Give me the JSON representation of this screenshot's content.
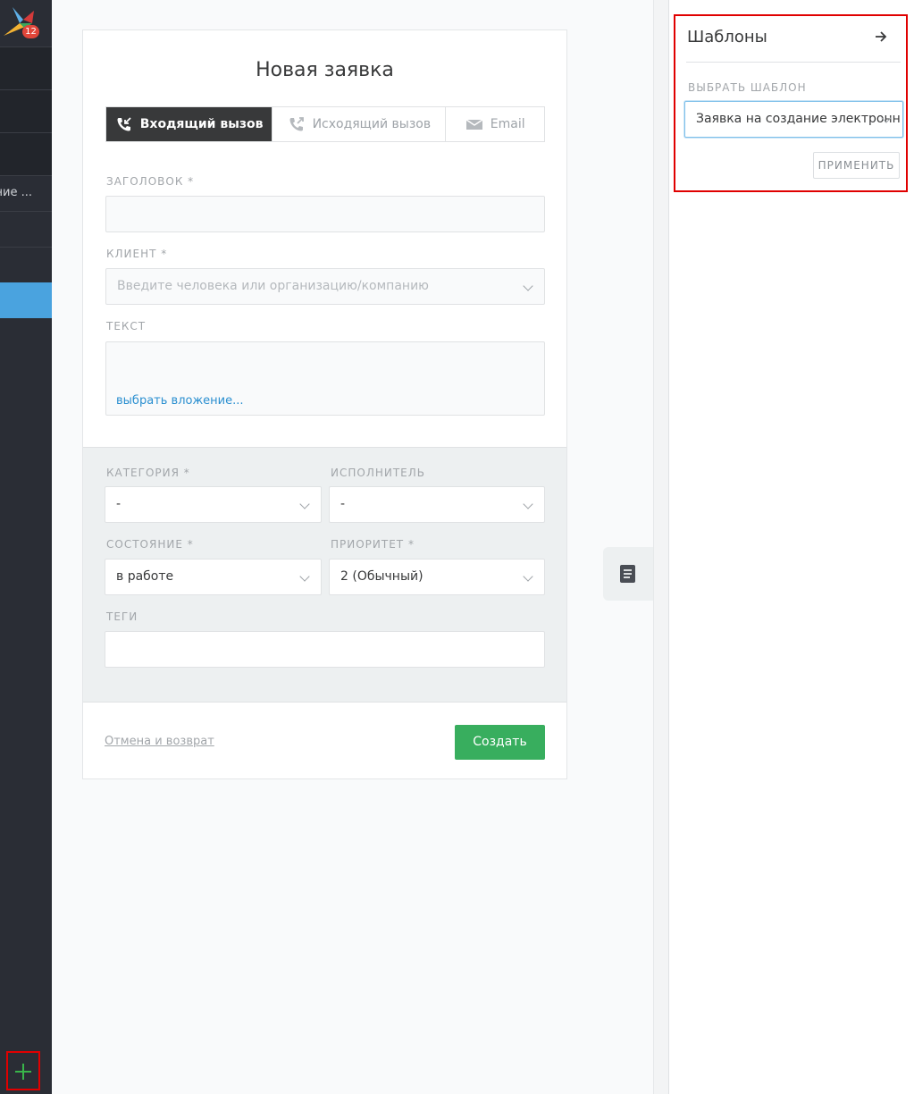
{
  "nav": {
    "badge_count": "12",
    "truncated_item_label": "ние ...",
    "add_button": "+"
  },
  "form": {
    "title": "Новая заявка",
    "tabs": [
      {
        "label": "Входящий вызов",
        "icon": "phone-incoming-icon",
        "active": true
      },
      {
        "label": "Исходящий вызов",
        "icon": "phone-outgoing-icon",
        "active": false
      },
      {
        "label": "Email",
        "icon": "envelope-icon",
        "active": false
      }
    ],
    "subject_label": "ЗАГОЛОВОК *",
    "subject_value": "",
    "customer_label": "КЛИЕНТ *",
    "customer_placeholder": "Введите человека или организацию/компанию",
    "text_label": "ТЕКСТ",
    "attach_link": "выбрать вложение...",
    "category_label": "КАТЕГОРИЯ *",
    "category_value": "-",
    "owner_label": "ИСПОЛНИТЕЛЬ",
    "owner_value": "-",
    "state_label": "СОСТОЯНИЕ *",
    "state_value": "в работе",
    "priority_label": "ПРИОРИТЕТ *",
    "priority_value": "2 (Обычный)",
    "tags_label": "ТЕГИ",
    "tags_value": "",
    "cancel_link": "Отмена и возврат",
    "create_button": "Создать"
  },
  "templates": {
    "title": "Шаблоны",
    "select_label": "ВЫБРАТЬ ШАБЛОН",
    "selected_template": "Заявка на создание электронн",
    "apply_button": "ПРИМЕНИТЬ"
  },
  "colors": {
    "nav_bg": "#2a2d35",
    "active_nav": "#4aa3df",
    "create_green": "#38ae5e",
    "highlight_red": "#e00000",
    "link_blue": "#2a8fd0"
  }
}
